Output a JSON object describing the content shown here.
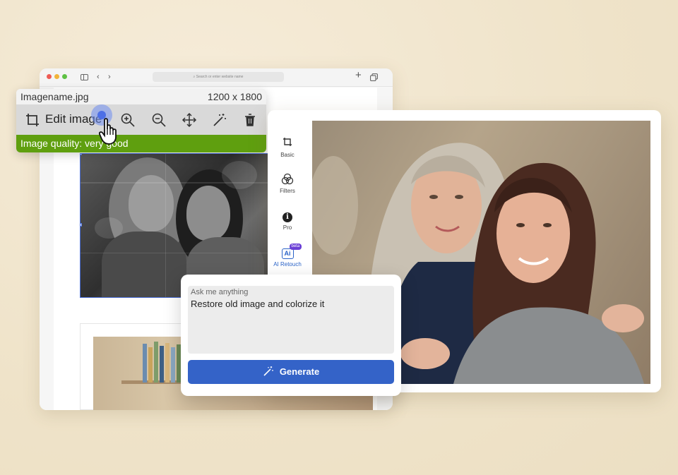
{
  "browser": {
    "url_placeholder": "Search or enter website name",
    "new_tab_icon": "plus-icon",
    "tabs_icon": "tabs-overview-icon"
  },
  "tool_panel": {
    "file_name": "Imagename.jpg",
    "dimensions": "1200 x 1800",
    "edit_label": "Edit image",
    "quality_text": "Image quality: very good",
    "tools": [
      "crop-icon",
      "zoom-in-icon",
      "zoom-out-icon",
      "move-icon",
      "magic-wand-icon",
      "trash-icon"
    ]
  },
  "editor": {
    "side_tools": [
      {
        "label": "Basic",
        "icon": "crop-icon"
      },
      {
        "label": "Filters",
        "icon": "filters-icon"
      },
      {
        "label": "Pro",
        "icon": "info-icon"
      },
      {
        "label": "AI Retouch",
        "icon": "ai-icon",
        "badge": "beta",
        "ai_text": "Ai"
      }
    ]
  },
  "prompt": {
    "placeholder": "Ask me anything",
    "text": "Restore old image and colorize it",
    "button_label": "Generate"
  },
  "colors": {
    "background": "#f1e6cf",
    "quality_green": "#5f9f0f",
    "generate_blue": "#3463c8",
    "beta_purple": "#6b3fd6"
  }
}
